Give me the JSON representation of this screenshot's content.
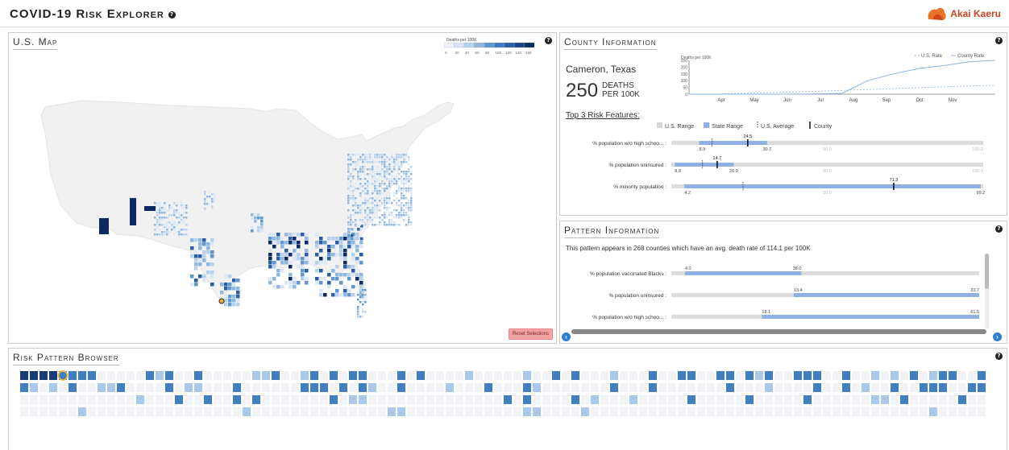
{
  "app": {
    "title": "COVID-19 Risk Explorer",
    "help": "?",
    "brand": "Akai Kaeru"
  },
  "map_panel": {
    "title": "U.S. Map",
    "help": "?",
    "legend_title": "Deaths per 100K",
    "legend_ticks": [
      "0",
      "20",
      "40",
      "60",
      "80",
      "100",
      "120",
      "140",
      "160"
    ],
    "legend_colors": [
      "#eef3fa",
      "#d6e4f4",
      "#b7d0ec",
      "#8fb7e0",
      "#5f98d0",
      "#3e7cc0",
      "#2a5fa6",
      "#1a4488",
      "#0b2a63"
    ],
    "reset_label": "Reset Selections"
  },
  "county_panel": {
    "title": "County Information",
    "help": "?",
    "county_name": "Cameron, Texas",
    "deaths": "250",
    "deaths_label_1": "DEATHS",
    "deaths_label_2": "PER 100K",
    "top_features_title": "Top 3 Risk Features:",
    "legend": {
      "us_range": "U.S. Range",
      "state_range": "State Range",
      "us_average": "U.S. Average",
      "county": "County"
    },
    "features": [
      {
        "label": "% population w/o high schoo... :",
        "min_label": "8.9",
        "max_label": "30.7",
        "value_label": "24.5",
        "mid_label": "50.0",
        "end_label": "100.0",
        "range": [
          8.9,
          30.7
        ],
        "value": 24.5,
        "avg": 13.0,
        "domain": [
          0,
          100
        ]
      },
      {
        "label": "% population uninsured :",
        "min_label": "8.8",
        "max_label": "20.0",
        "value_label": "14.7",
        "mid_label": "50.0",
        "end_label": "100.0",
        "range": [
          1.1,
          20.0
        ],
        "value": 14.7,
        "avg": 10.0,
        "domain": [
          0,
          100
        ]
      },
      {
        "label": "% minority population :",
        "min_label": "4.2",
        "max_label": "99.2",
        "value_label": "71.3",
        "mid_label": "50.0",
        "end_label": "",
        "range": [
          4.2,
          99.2
        ],
        "value": 71.3,
        "avg": 23.0,
        "domain": [
          0,
          100
        ]
      }
    ],
    "chart_data": {
      "type": "line",
      "ylabel": "Deaths per 100K",
      "yticks": [
        "250",
        "200",
        "150",
        "100",
        "50",
        "0"
      ],
      "categories": [
        "Apr",
        "May",
        "Jun",
        "Jul",
        "Aug",
        "Sep",
        "Oct",
        "Nov"
      ],
      "ylim": [
        0,
        250
      ],
      "series": [
        {
          "name": "U.S. Rate",
          "values": [
            0,
            2,
            8,
            14,
            20,
            28,
            36,
            44,
            52,
            60,
            66
          ]
        },
        {
          "name": "County Rate",
          "values": [
            0,
            0,
            0,
            0,
            0,
            2,
            6,
            100,
            150,
            190,
            212,
            240,
            250
          ]
        }
      ]
    }
  },
  "pattern_panel": {
    "title": "Pattern Information",
    "help": "?",
    "description": "This pattern appears in 268 counties which have an avg. death rate of 114.1 per 100K",
    "features": [
      {
        "label": "% population vaccinated Blacks :",
        "lo": "4.0",
        "hi": "38.0",
        "range": [
          4.0,
          38.0
        ],
        "domain": [
          0,
          90
        ]
      },
      {
        "label": "% population uninsured :",
        "lo": "13.4",
        "hi": "33.7",
        "range": [
          13.4,
          33.7
        ],
        "domain": [
          0,
          33.7
        ]
      },
      {
        "label": "% population w/o high schoo... :",
        "lo": "18.1",
        "hi": "61.5",
        "range": [
          18.1,
          61.5
        ],
        "domain": [
          0,
          61.5
        ]
      }
    ]
  },
  "browser_panel": {
    "title": "Risk Pattern Browser",
    "help": "?"
  }
}
